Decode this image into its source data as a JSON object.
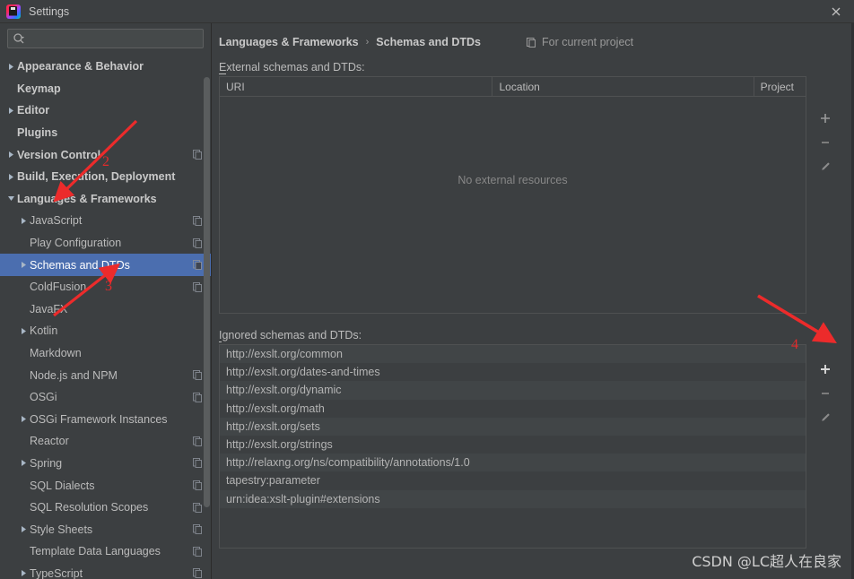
{
  "window": {
    "title": "Settings",
    "logo_icon": "intellij-idea-logo",
    "close_icon": "close-icon"
  },
  "search": {
    "placeholder": "",
    "value": "",
    "icon": "search-icon"
  },
  "sidebar": {
    "scrollbar": "vertical-scrollbar",
    "items": [
      {
        "label": "Appearance & Behavior",
        "indent": 0,
        "arrow": "collapsed",
        "bold": true,
        "badge": false,
        "selected": false
      },
      {
        "label": "Keymap",
        "indent": 0,
        "arrow": "none",
        "bold": true,
        "badge": false,
        "selected": false
      },
      {
        "label": "Editor",
        "indent": 0,
        "arrow": "collapsed",
        "bold": true,
        "badge": false,
        "selected": false
      },
      {
        "label": "Plugins",
        "indent": 0,
        "arrow": "none",
        "bold": true,
        "badge": false,
        "selected": false
      },
      {
        "label": "Version Control",
        "indent": 0,
        "arrow": "collapsed",
        "bold": true,
        "badge": true,
        "selected": false
      },
      {
        "label": "Build, Execution, Deployment",
        "indent": 0,
        "arrow": "collapsed",
        "bold": true,
        "badge": false,
        "selected": false
      },
      {
        "label": "Languages & Frameworks",
        "indent": 0,
        "arrow": "expanded",
        "bold": true,
        "badge": false,
        "selected": false
      },
      {
        "label": "JavaScript",
        "indent": 1,
        "arrow": "collapsed",
        "bold": false,
        "badge": true,
        "selected": false
      },
      {
        "label": "Play Configuration",
        "indent": 1,
        "arrow": "none",
        "bold": false,
        "badge": true,
        "selected": false
      },
      {
        "label": "Schemas and DTDs",
        "indent": 1,
        "arrow": "collapsed",
        "bold": false,
        "badge": true,
        "selected": true
      },
      {
        "label": "ColdFusion",
        "indent": 1,
        "arrow": "none",
        "bold": false,
        "badge": true,
        "selected": false
      },
      {
        "label": "JavaFX",
        "indent": 1,
        "arrow": "none",
        "bold": false,
        "badge": false,
        "selected": false
      },
      {
        "label": "Kotlin",
        "indent": 1,
        "arrow": "collapsed",
        "bold": false,
        "badge": false,
        "selected": false
      },
      {
        "label": "Markdown",
        "indent": 1,
        "arrow": "none",
        "bold": false,
        "badge": false,
        "selected": false
      },
      {
        "label": "Node.js and NPM",
        "indent": 1,
        "arrow": "none",
        "bold": false,
        "badge": true,
        "selected": false
      },
      {
        "label": "OSGi",
        "indent": 1,
        "arrow": "none",
        "bold": false,
        "badge": true,
        "selected": false
      },
      {
        "label": "OSGi Framework Instances",
        "indent": 1,
        "arrow": "collapsed",
        "bold": false,
        "badge": false,
        "selected": false
      },
      {
        "label": "Reactor",
        "indent": 1,
        "arrow": "none",
        "bold": false,
        "badge": true,
        "selected": false
      },
      {
        "label": "Spring",
        "indent": 1,
        "arrow": "collapsed",
        "bold": false,
        "badge": true,
        "selected": false
      },
      {
        "label": "SQL Dialects",
        "indent": 1,
        "arrow": "none",
        "bold": false,
        "badge": true,
        "selected": false
      },
      {
        "label": "SQL Resolution Scopes",
        "indent": 1,
        "arrow": "none",
        "bold": false,
        "badge": true,
        "selected": false
      },
      {
        "label": "Style Sheets",
        "indent": 1,
        "arrow": "collapsed",
        "bold": false,
        "badge": true,
        "selected": false
      },
      {
        "label": "Template Data Languages",
        "indent": 1,
        "arrow": "none",
        "bold": false,
        "badge": true,
        "selected": false
      },
      {
        "label": "TypeScript",
        "indent": 1,
        "arrow": "collapsed",
        "bold": false,
        "badge": true,
        "selected": false
      }
    ]
  },
  "content": {
    "breadcrumb": {
      "parent": "Languages & Frameworks",
      "separator": "›",
      "current": "Schemas and DTDs"
    },
    "scope": {
      "icon": "project-scope-icon",
      "label": "For current project"
    },
    "external": {
      "label_prefix": "E",
      "label_rest": "xternal schemas and DTDs:",
      "columns": [
        "URI",
        "Location",
        "Project"
      ],
      "rows": [],
      "empty_text": "No external resources",
      "toolbar": [
        {
          "icon": "add-icon",
          "name": "add-external-schema-button"
        },
        {
          "icon": "remove-icon",
          "name": "remove-external-schema-button"
        },
        {
          "icon": "edit-icon",
          "name": "edit-external-schema-button"
        }
      ]
    },
    "ignored": {
      "label_prefix": "I",
      "label_rest": "gnored schemas and DTDs:",
      "rows": [
        "http://exslt.org/common",
        "http://exslt.org/dates-and-times",
        "http://exslt.org/dynamic",
        "http://exslt.org/math",
        "http://exslt.org/sets",
        "http://exslt.org/strings",
        "http://relaxng.org/ns/compatibility/annotations/1.0",
        "tapestry:parameter",
        "urn:idea:xslt-plugin#extensions"
      ],
      "toolbar": [
        {
          "icon": "add-icon",
          "name": "add-ignored-schema-button"
        },
        {
          "icon": "remove-icon",
          "name": "remove-ignored-schema-button"
        },
        {
          "icon": "edit-icon",
          "name": "edit-ignored-schema-button"
        }
      ]
    }
  },
  "annotations": {
    "color": "#ec2b2b",
    "markers": [
      {
        "label": "2"
      },
      {
        "label": "3"
      },
      {
        "label": "4"
      }
    ]
  },
  "watermark": {
    "text": "CSDN @LC超人在良家"
  }
}
